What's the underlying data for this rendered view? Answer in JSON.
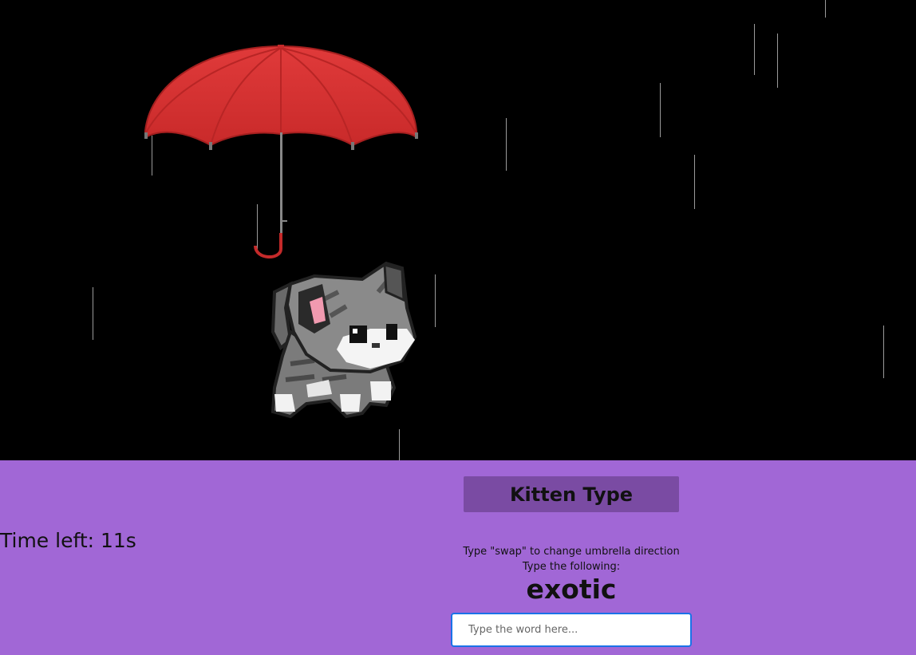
{
  "scene": {
    "umbrella_icon": "umbrella-icon",
    "kitten_icon": "kitten-icon",
    "raindrop_icon": "raindrop-icon",
    "colors": {
      "umbrella": "#d83434",
      "sky": "#000000",
      "panel": "#a167d6",
      "title_box": "#7a4ba3"
    }
  },
  "game": {
    "title": "Kitten Type",
    "timer": "Time left: 11s",
    "instruction_swap": "Type \"swap\" to change umbrella direction",
    "instruction_type": "Type the following:",
    "target_word": "exotic",
    "input_placeholder": "Type the word here...",
    "input_value": ""
  }
}
